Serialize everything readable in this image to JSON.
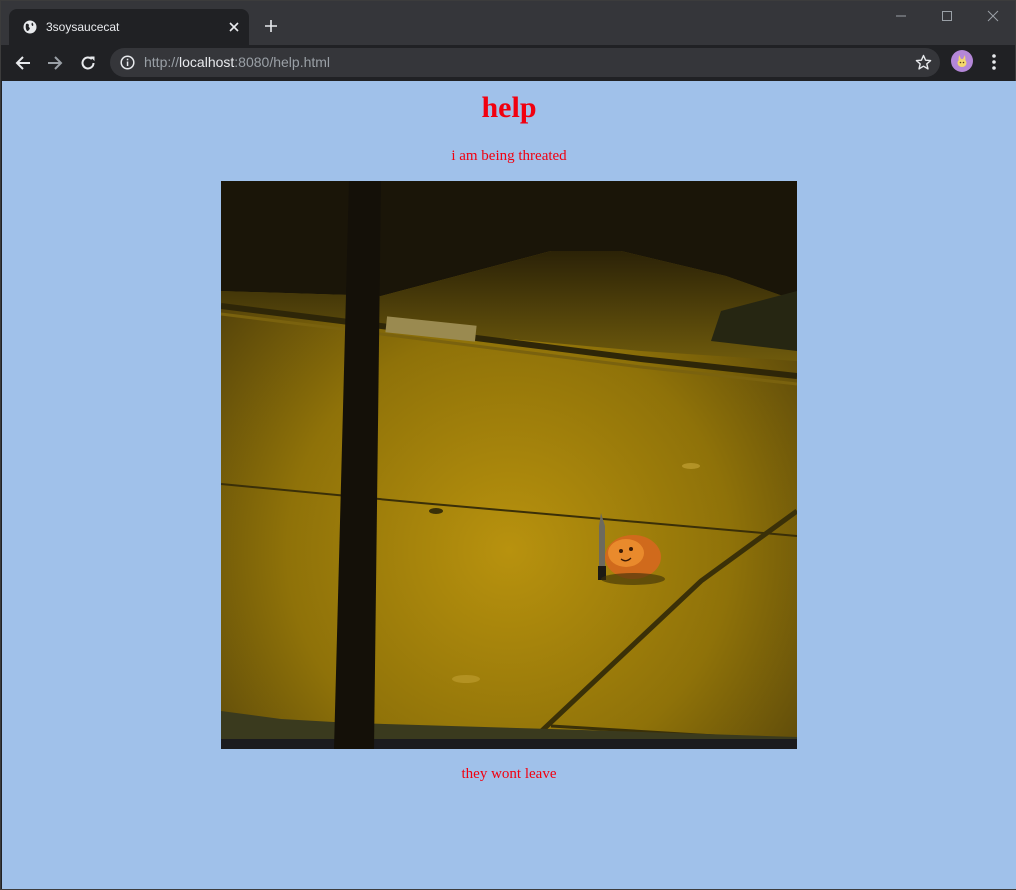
{
  "browser": {
    "tab_title": "3soysaucecat",
    "url_scheme": "http://",
    "url_host": "localhost",
    "url_rest": ":8080/help.html"
  },
  "page": {
    "heading": "help",
    "subtitle": "i am being threated",
    "image_alt": "cat with knife on a night-lit sidewalk",
    "caption": "they wont leave"
  },
  "colors": {
    "page_background": "#a0c1ea",
    "text_red": "#f1000f"
  }
}
